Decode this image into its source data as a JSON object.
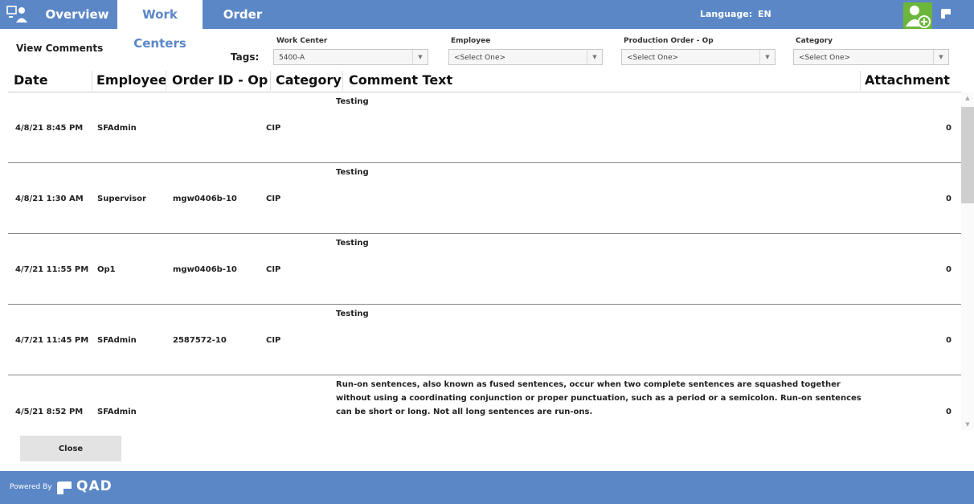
{
  "nav": {
    "tabs": [
      {
        "label": "Overview",
        "active": false
      },
      {
        "label": "Work Centers",
        "active": true
      },
      {
        "label": "Order Mgmt",
        "active": false
      }
    ],
    "language_label": "Language:",
    "language_value": "EN",
    "brand": "QAD"
  },
  "panel": {
    "title": "View Comments",
    "tags_label": "Tags:",
    "filters": [
      {
        "label": "Work Center",
        "value": "5400-A"
      },
      {
        "label": "Employee",
        "value": "<Select One>"
      },
      {
        "label": "Production Order - Op",
        "value": "<Select One>"
      },
      {
        "label": "Category",
        "value": "<Select One>"
      }
    ]
  },
  "table": {
    "headers": [
      "Date",
      "Employee",
      "Order ID - Op",
      "Category",
      "Comment Text",
      "Attachment"
    ],
    "rows": [
      {
        "date": "4/8/21 8:45 PM",
        "employee": "SFAdmin",
        "order": "",
        "category": "CIP",
        "comment": "Testing",
        "attachment": "0"
      },
      {
        "date": "4/8/21 1:30 AM",
        "employee": "Supervisor",
        "order": "mgw0406b-10",
        "category": "CIP",
        "comment": "Testing",
        "attachment": "0"
      },
      {
        "date": "4/7/21 11:55 PM",
        "employee": "Op1",
        "order": "mgw0406b-10",
        "category": "CIP",
        "comment": "Testing",
        "attachment": "0"
      },
      {
        "date": "4/7/21 11:45 PM",
        "employee": "SFAdmin",
        "order": "2587572-10",
        "category": "CIP",
        "comment": "Testing",
        "attachment": "0"
      },
      {
        "date": "4/5/21 8:52 PM",
        "employee": "SFAdmin",
        "order": "",
        "category": "",
        "comment": "Run-on sentences, also known as fused sentences, occur when two complete sentences are squashed together without using a coordinating conjunction or proper punctuation, such as a period or a semicolon. Run-on sentences can be short or long. Not all long sentences are run-ons.",
        "attachment": "0"
      }
    ]
  },
  "close_label": "Close",
  "footer": {
    "powered_by": "Powered By",
    "brand": "QAD"
  },
  "colors": {
    "header_blue": "#5b87c7",
    "user_green": "#6cb63c"
  }
}
